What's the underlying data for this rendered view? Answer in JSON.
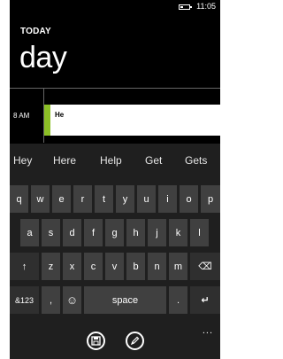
{
  "status": {
    "time": "11:05"
  },
  "header": {
    "label": "TODAY",
    "title": "day"
  },
  "calendar": {
    "time_label": "8 AM",
    "event_title": "He"
  },
  "suggestions": [
    "Hey",
    "Here",
    "Help",
    "Get",
    "Gets"
  ],
  "keyboard": {
    "row1": [
      "q",
      "w",
      "e",
      "r",
      "t",
      "y",
      "u",
      "i",
      "o",
      "p"
    ],
    "row2": [
      "a",
      "s",
      "d",
      "f",
      "g",
      "h",
      "j",
      "k",
      "l"
    ],
    "row3": [
      "↑",
      "z",
      "x",
      "c",
      "v",
      "b",
      "n",
      "m",
      "⌫"
    ],
    "row4": [
      "&123",
      ",",
      "☺",
      "space",
      ".",
      "↵"
    ]
  },
  "appbar": {
    "save_icon": "save-icon",
    "edit_icon": "edit-icon",
    "more": "..."
  },
  "colors": {
    "accent": "#8cbf26"
  }
}
